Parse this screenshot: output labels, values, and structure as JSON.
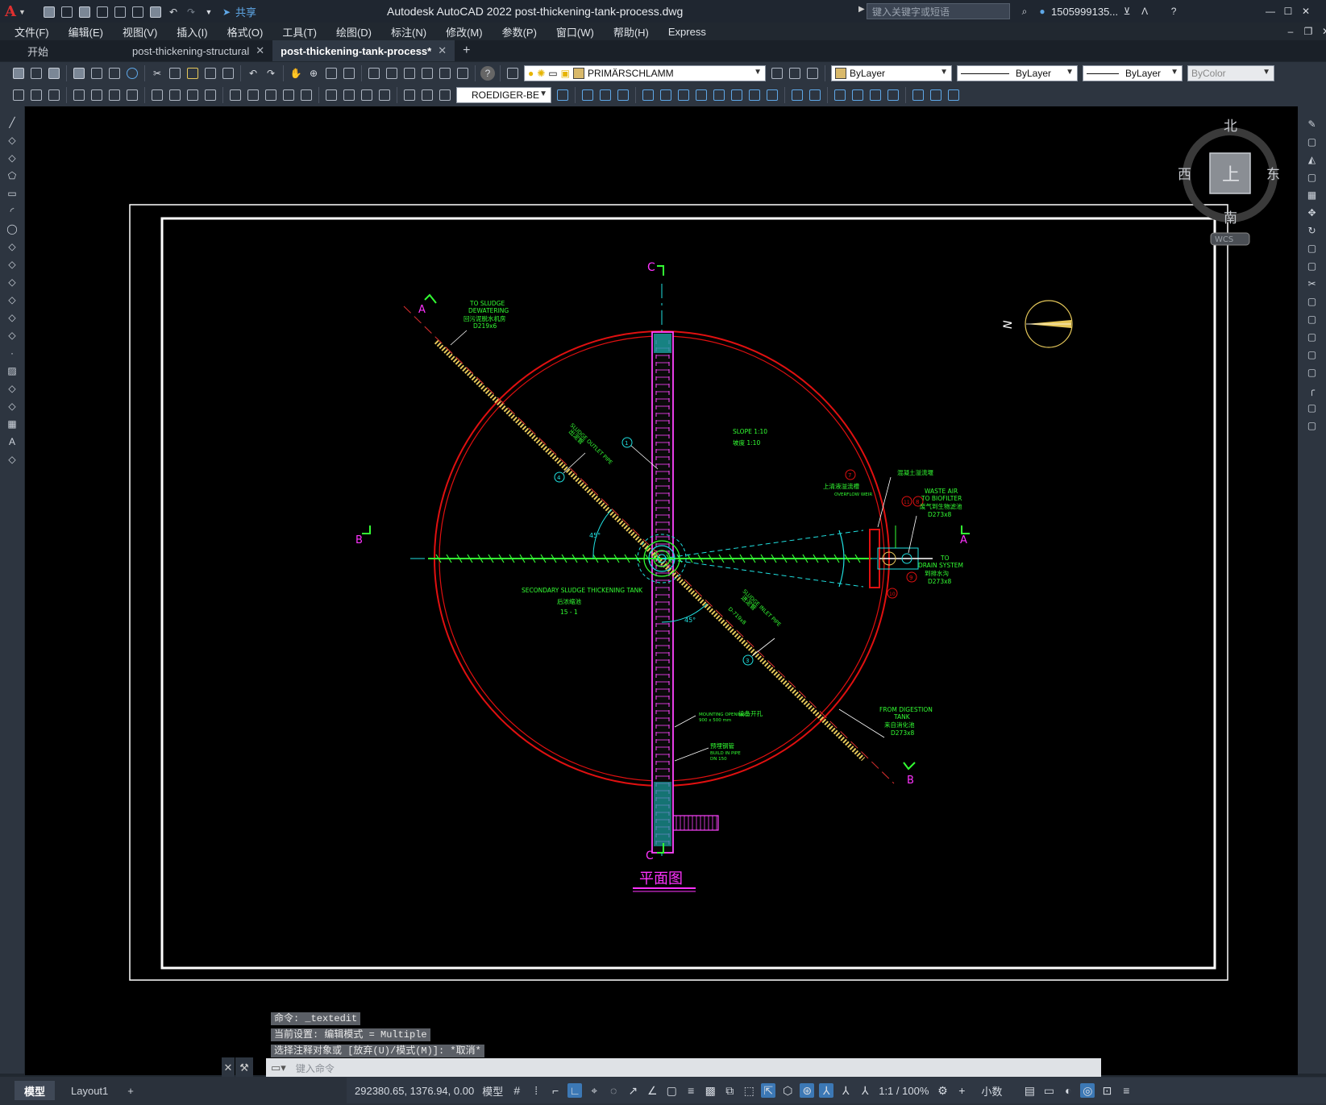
{
  "window": {
    "title": "Autodesk AutoCAD 2022    post-thickening-tank-process.dwg",
    "share_label": "共享",
    "search_placeholder": "键入关键字或短语",
    "user": "1505999135...",
    "controls": [
      "—",
      "☐",
      "✕"
    ]
  },
  "menu": [
    "文件(F)",
    "编辑(E)",
    "视图(V)",
    "插入(I)",
    "格式(O)",
    "工具(T)",
    "绘图(D)",
    "标注(N)",
    "修改(M)",
    "参数(P)",
    "窗口(W)",
    "帮助(H)",
    "Express"
  ],
  "tabs": [
    {
      "label": "开始",
      "active": false
    },
    {
      "label": "post-thickening-structural",
      "active": false
    },
    {
      "label": "post-thickening-tank-process*",
      "active": true
    }
  ],
  "properties_bar": {
    "layer": "PRIMÄRSCHLAMM",
    "color": "ByLayer",
    "linetype": "ByLayer",
    "lineweight": "ByLayer",
    "plotstyle": "ByColor",
    "dimstyle": "ROEDIGER-BE"
  },
  "viewcube": {
    "north": "北",
    "south": "南",
    "east": "东",
    "west": "西",
    "face": "上",
    "wcs": "WCS"
  },
  "drawing": {
    "section_c": "C",
    "section_a": "A",
    "section_b": "B",
    "to_sludge_1": "TO SLUDGE",
    "to_sludge_2": "DEWATERING",
    "to_sludge_cn": "回污泥脱水机房",
    "to_sludge_size": "D219x6",
    "slope_en": "SLOPE 1:10",
    "slope_cn": "坡度 1:10",
    "outlet_pipe": "SLUDGE OUTLET PIPE",
    "outlet_pipe_cn": "出泥管",
    "inlet_pipe": "SLUDGE INLET PIPE",
    "inlet_pipe_cn": "进泥管",
    "inlet_size": "D-719x8",
    "tank_en": "SECONDARY SLUDGE THICKENING TANK",
    "tank_cn": "后浓缩池",
    "tank_id": "15 - 1",
    "concrete_cn": "混凝土溢流堰",
    "overflow_cn": "上清液溢流槽",
    "overflow_en": "OVERFLOW WEIR",
    "waste_air_1": "WASTE AIR",
    "waste_air_2": "TO BIOFILTER",
    "waste_air_cn": "废气到生物滤池",
    "waste_air_size": "D273x8",
    "drain_1": "TO",
    "drain_2": "DRAIN SYSTEM",
    "drain_cn": "到排水沟",
    "drain_size": "D273x8",
    "digestion_1": "FROM DIGESTION",
    "digestion_2": "TANK",
    "digestion_cn": "来自消化池",
    "digestion_size": "D273x8",
    "mounting_en": "MOUNTING OPENING",
    "mounting_cn": "设备开孔",
    "mounting_size": "900 x 500 mm",
    "build_cn": "预埋钢管",
    "build_en": "BUILD IN PIPE",
    "build_size": "DN 150",
    "callouts": [
      "1",
      "3",
      "4",
      "7",
      "8",
      "9",
      "10",
      "11"
    ],
    "angle_45": "45°",
    "north_arrow": "N",
    "plan_title": "平面图"
  },
  "command": {
    "history": [
      "命令: _textedit",
      "当前设置: 编辑模式 = Multiple",
      "选择注释对象或 [放弃(U)/模式(M)]: *取消*"
    ],
    "placeholder": "键入命令"
  },
  "layout_tabs": [
    "模型",
    "Layout1",
    "+"
  ],
  "status": {
    "coords": "292380.65, 1376.94, 0.00",
    "space": "模型",
    "scale": "1:1 / 100%",
    "units": "小数"
  },
  "colors": {
    "tank_circle": "#e01010",
    "wall": "#ff44ff",
    "pipe": "#e6c85a",
    "annotation": "#33ff33",
    "cyan": "#20e0e0",
    "section": "#ff33ff",
    "frame": "#ffffff"
  }
}
